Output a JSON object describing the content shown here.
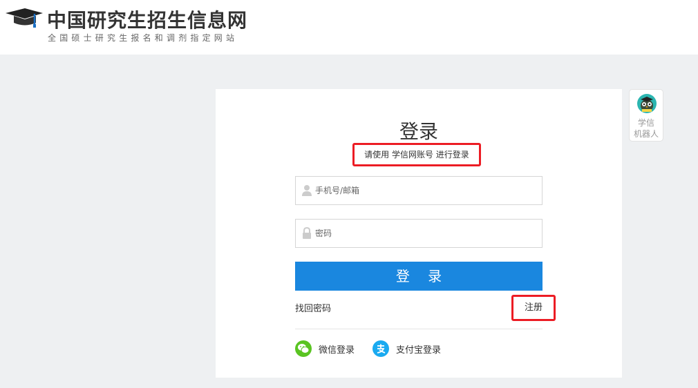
{
  "header": {
    "title": "中国研究生招生信息网",
    "subtitle": "全国硕士研究生报名和调剂指定网站",
    "logo_icon": "graduation-cap-icon"
  },
  "login": {
    "title": "登录",
    "hint": "请使用 学信网账号 进行登录",
    "username_placeholder": "手机号/邮箱",
    "username_icon": "user-icon",
    "password_placeholder": "密码",
    "password_icon": "lock-icon",
    "submit_label": "登 录",
    "forgot_label": "找回密码",
    "register_label": "注册",
    "wechat_label": "微信登录",
    "wechat_icon": "wechat-icon",
    "alipay_label": "支付宝登录",
    "alipay_icon": "alipay-icon"
  },
  "robot": {
    "line1": "学信",
    "line2": "机器人",
    "icon": "robot-owl-icon"
  },
  "colors": {
    "primary": "#1a87df",
    "highlight": "#ec1c24",
    "wechat": "#5ac422",
    "alipay": "#1aaaf0",
    "background": "#eef0f2"
  }
}
